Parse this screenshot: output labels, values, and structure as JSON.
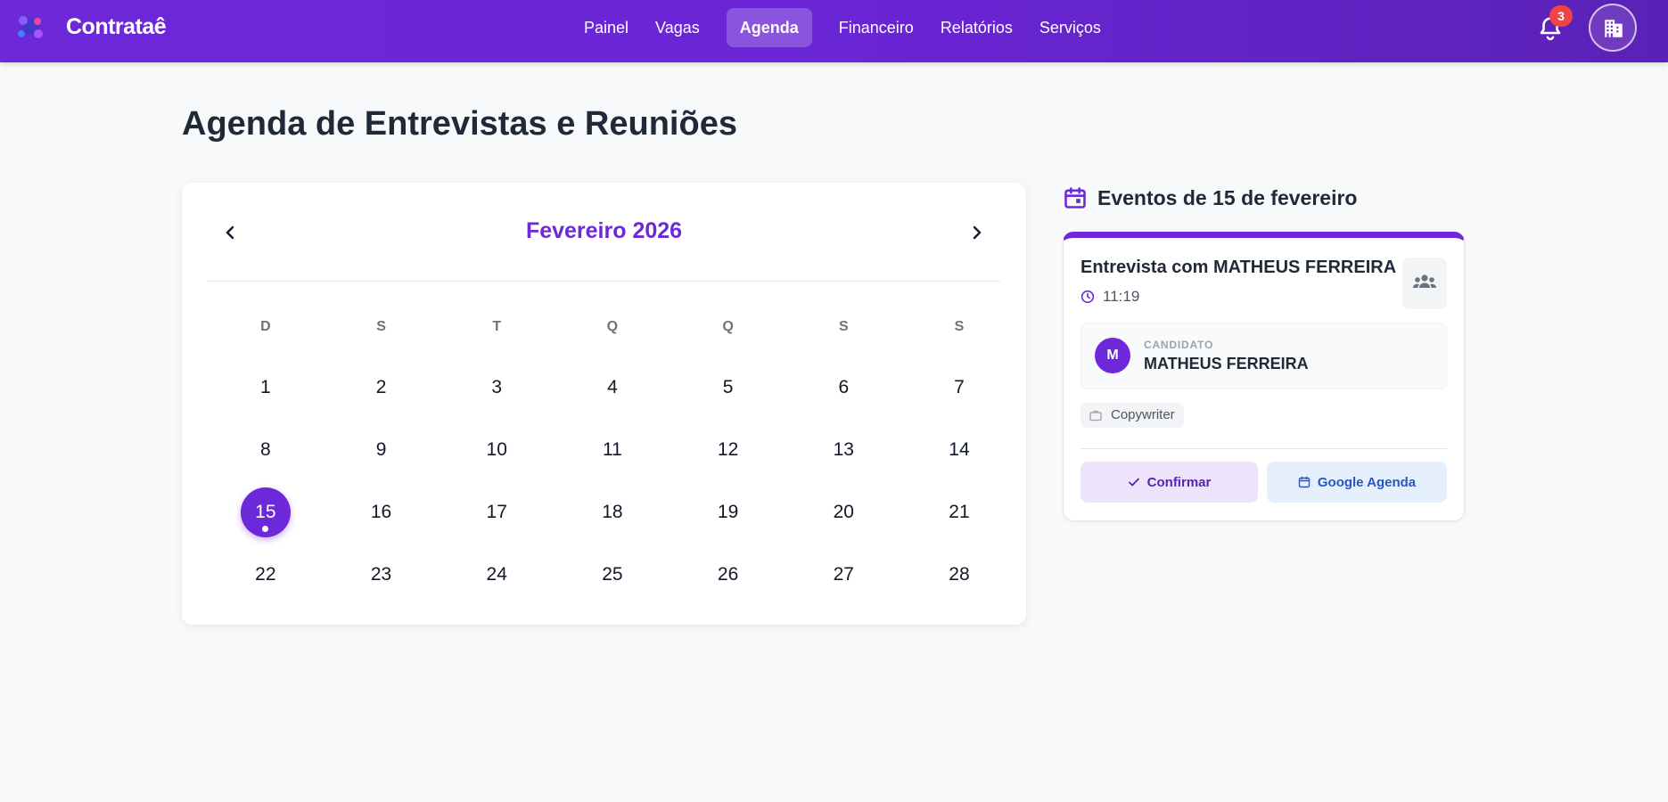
{
  "brand": {
    "name": "Contrataê"
  },
  "nav": {
    "items": [
      {
        "label": "Painel"
      },
      {
        "label": "Vagas"
      },
      {
        "label": "Agenda",
        "active": true
      },
      {
        "label": "Financeiro"
      },
      {
        "label": "Relatórios"
      },
      {
        "label": "Serviços"
      }
    ]
  },
  "notifications": {
    "count": "3",
    "icon": "bell-icon"
  },
  "profile": {
    "icon": "building-icon"
  },
  "page": {
    "title": "Agenda de Entrevistas e Reuniões"
  },
  "calendar": {
    "month_label": "Fevereiro 2026",
    "weekdays": [
      "D",
      "S",
      "T",
      "Q",
      "Q",
      "S",
      "S"
    ],
    "days": [
      "1",
      "2",
      "3",
      "4",
      "5",
      "6",
      "7",
      "8",
      "9",
      "10",
      "11",
      "12",
      "13",
      "14",
      "15",
      "16",
      "17",
      "18",
      "19",
      "20",
      "21",
      "22",
      "23",
      "24",
      "25",
      "26",
      "27",
      "28"
    ],
    "selected_day": "15",
    "days_with_events": [
      "15"
    ]
  },
  "events": {
    "heading": "Eventos de 15 de fevereiro",
    "items": [
      {
        "title": "Entrevista com MATHEUS FERREIRA",
        "time": "11:19",
        "type_icon": "people-group-icon",
        "candidate_label": "CANDIDATO",
        "candidate_initial": "M",
        "candidate_name": "MATHEUS FERREIRA",
        "job": "Copywriter",
        "confirm_label": "Confirmar",
        "google_label": "Google Agenda"
      }
    ]
  },
  "colors": {
    "primary": "#6d28d9",
    "badge": "#ef4444",
    "google": "#2856c5"
  }
}
